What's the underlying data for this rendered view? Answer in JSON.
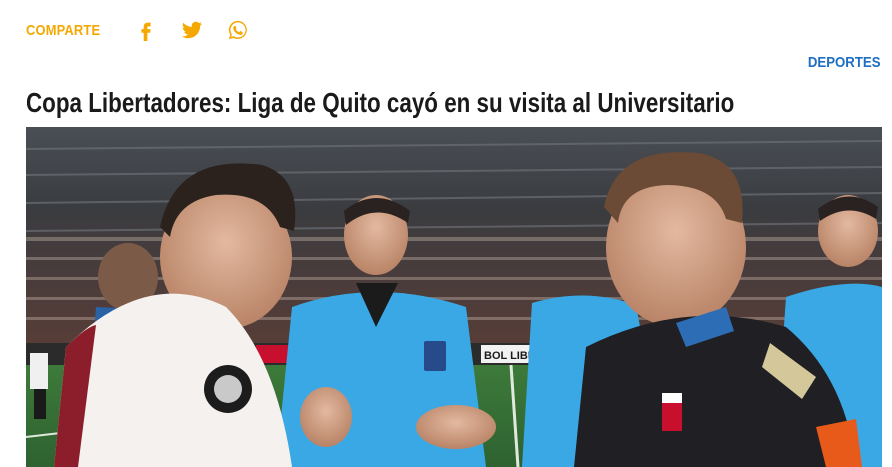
{
  "share": {
    "label": "COMPARTE",
    "icons": [
      "facebook-icon",
      "twitter-icon",
      "whatsapp-icon"
    ]
  },
  "category": "DEPORTES",
  "headline": "Copa Libertadores: Liga de Quito cayó en su visita al Universitario",
  "colors": {
    "accent": "#f5a800",
    "link": "#1e6fc4",
    "headline": "#1a1a1a"
  },
  "photo": {
    "banner_text": "BOL LIBE"
  }
}
